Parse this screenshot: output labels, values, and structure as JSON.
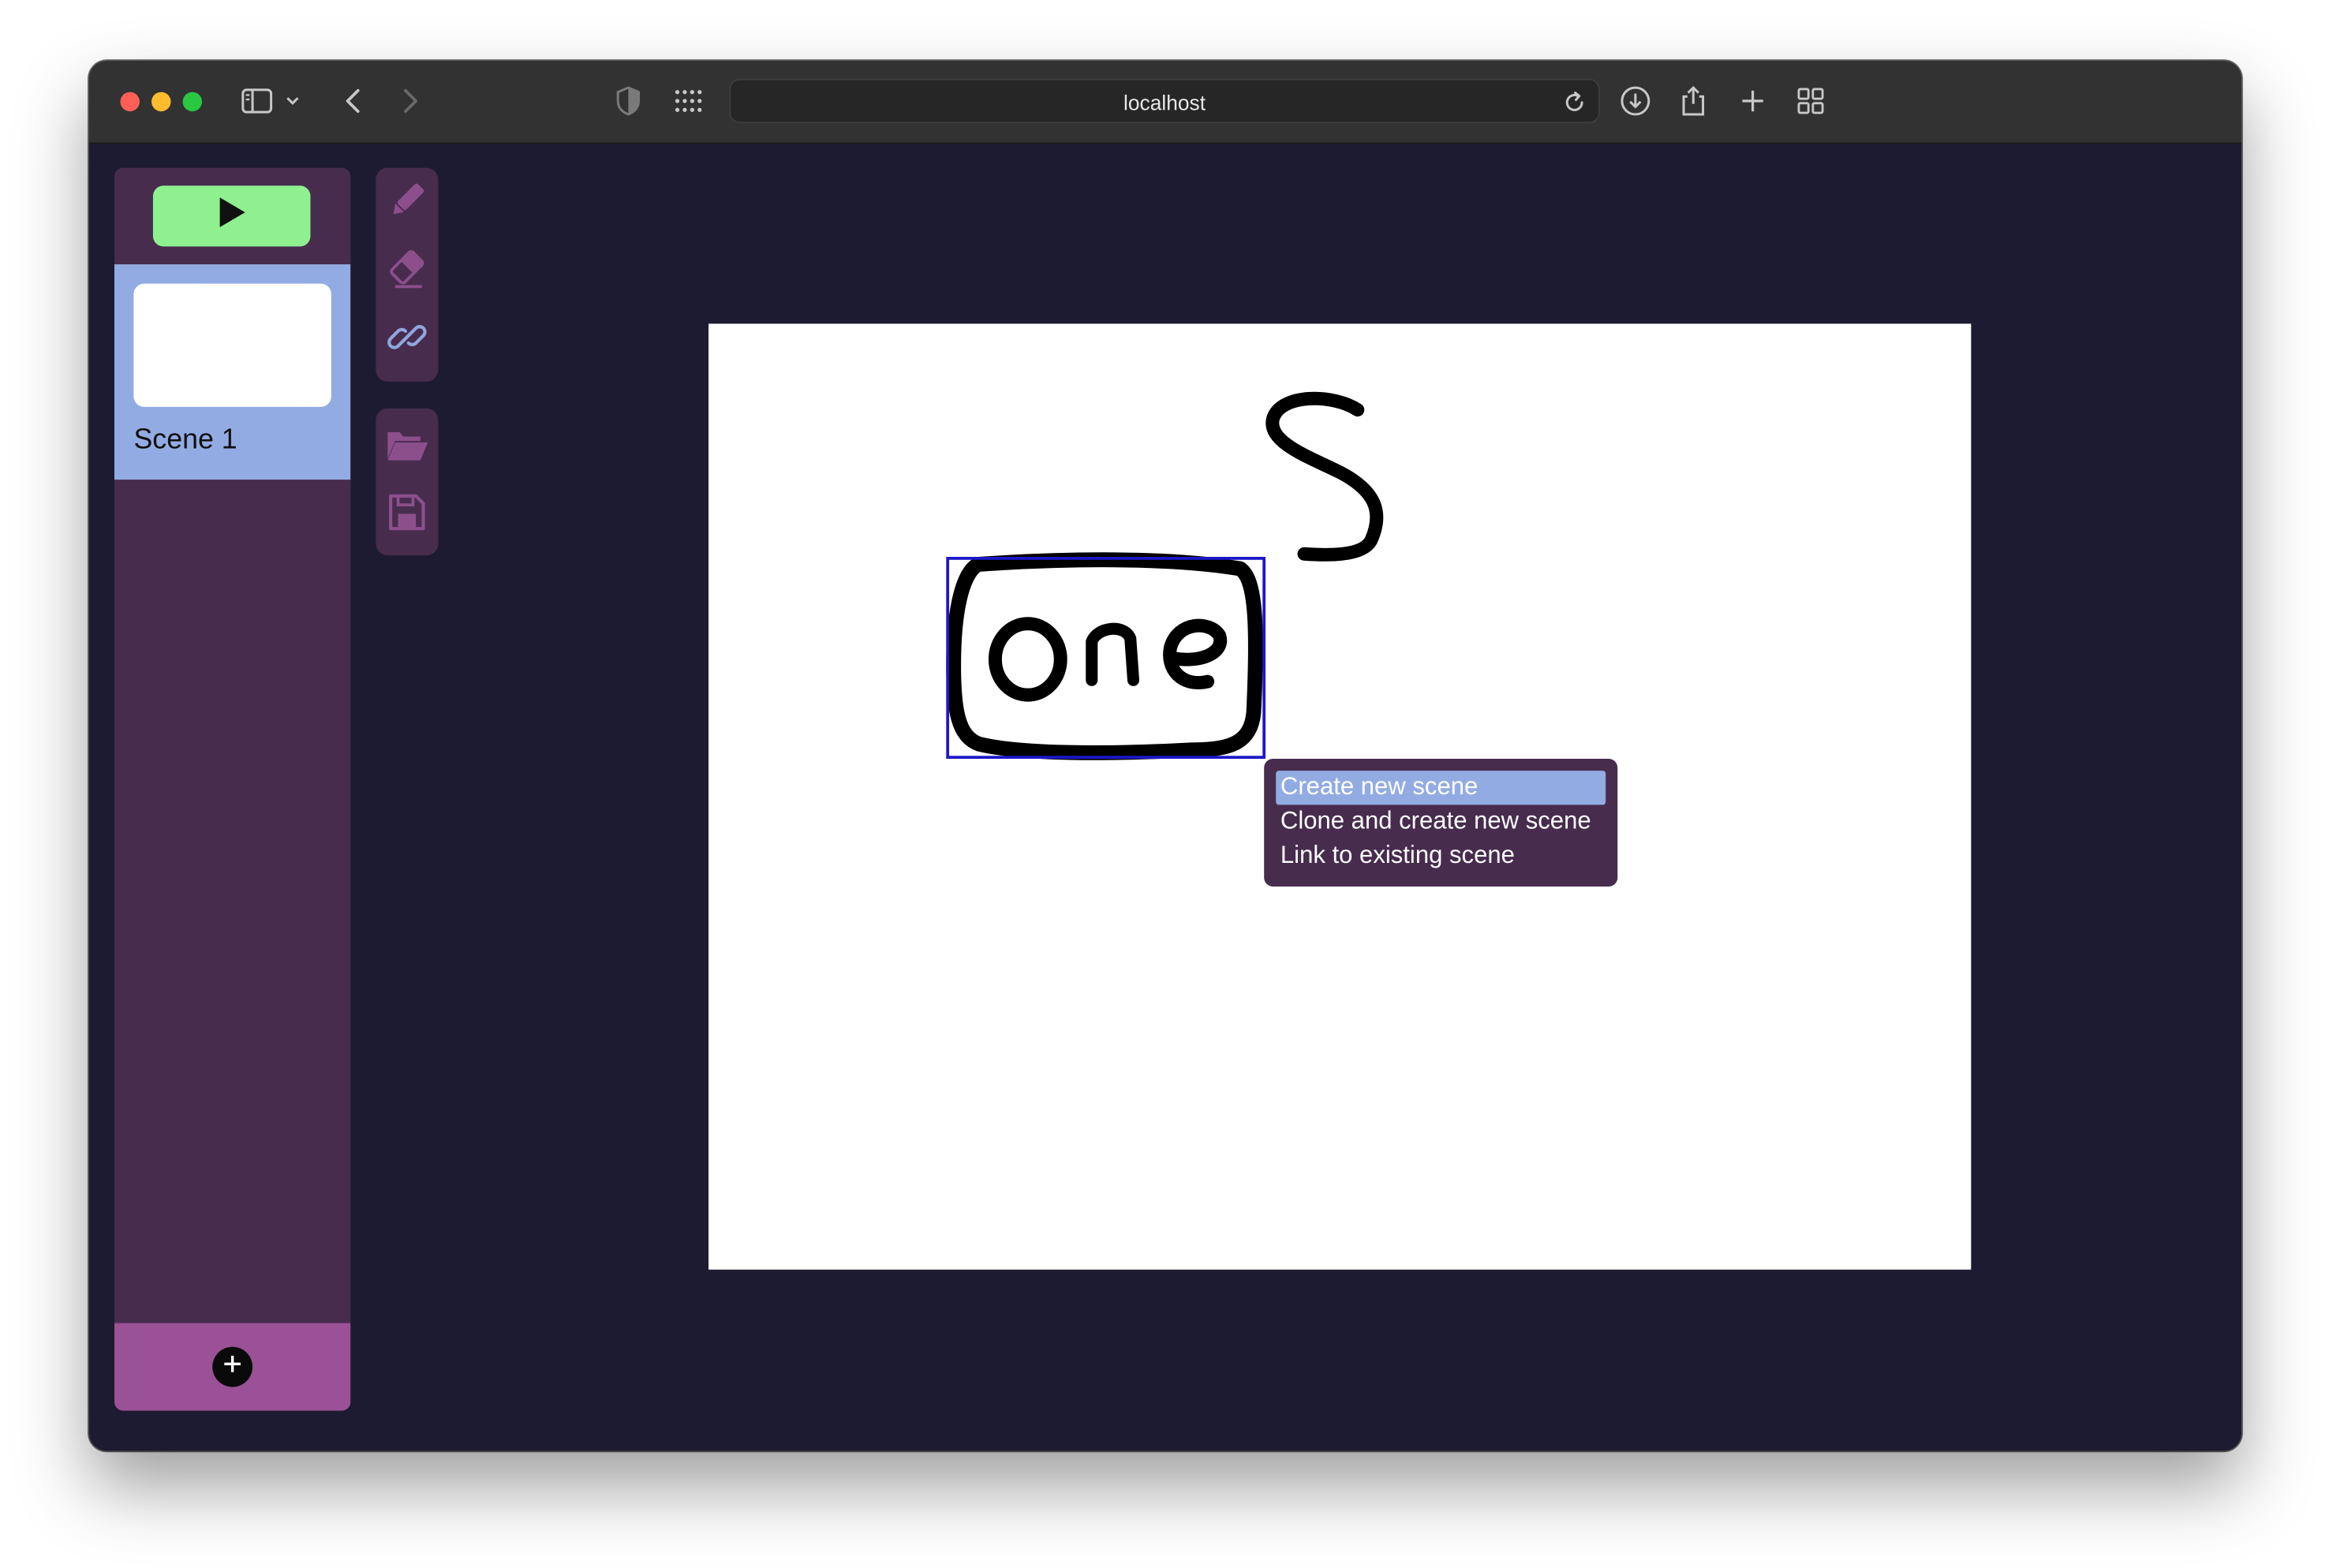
{
  "browser": {
    "url": "localhost"
  },
  "toolbar": {
    "icons": [
      "sidebar-icon",
      "chevron-down-icon",
      "back-icon",
      "forward-icon",
      "shield-icon",
      "grid-icon",
      "reload-icon",
      "download-icon",
      "share-icon",
      "plus-icon",
      "tabs-overview-icon"
    ]
  },
  "scenes": {
    "play_icon": "play-icon",
    "items": [
      {
        "label": "Scene 1",
        "selected": true
      }
    ],
    "add_icon": "plus-icon"
  },
  "tools": {
    "draw_group": [
      "pencil-icon",
      "eraser-icon",
      "link-icon"
    ],
    "file_group": [
      "folder-open-icon",
      "save-icon"
    ]
  },
  "canvas": {
    "drawing_text": "One",
    "context_menu": {
      "items": [
        {
          "label": "Create new scene",
          "active": true
        },
        {
          "label": "Clone and create new scene",
          "active": false
        },
        {
          "label": "Link to existing scene",
          "active": false
        }
      ]
    }
  },
  "colors": {
    "app_background": "#1d1b31",
    "panel": "#472c4e",
    "selected_scene": "#92ace3",
    "play_button": "#8ef08f",
    "add_bar": "#9a5195",
    "tool_icon": "#8c4f8c",
    "link_icon": "#8fa7dc",
    "selection_box": "#1d17c9"
  }
}
